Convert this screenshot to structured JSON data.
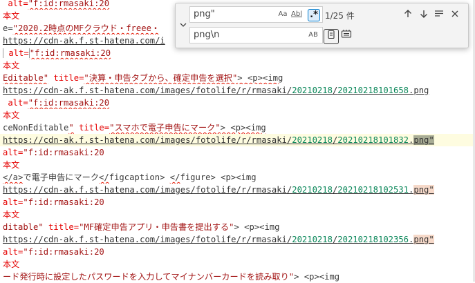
{
  "find_widget": {
    "find_value": "png\"",
    "replace_value": "png\\n",
    "match_case_label": "Aa",
    "whole_word_label": "Abl",
    "regex_label": ".*",
    "match_count": "1/25 件",
    "preserve_case_label": "AB",
    "toggle_icon": "chevron-down",
    "up_icon": "arrow-up",
    "down_icon": "arrow-down",
    "selection_icon": "find-in-selection",
    "close_icon": "close",
    "replace_one_icon": "replace",
    "replace_all_icon": "replace-all"
  },
  "colors": {
    "attr": "#e50000",
    "string": "#a31515",
    "url": "#333333",
    "number": "#098658",
    "match": "#f6d9c9",
    "current_match": "#a8ac94",
    "current_line": "#fefce0"
  },
  "editor": {
    "lines": [
      {
        "segs": [
          {
            "t": " alt=",
            "c": "attr"
          },
          {
            "t": "\"f:id:rmasaki:20",
            "c": "val",
            "sq": true
          }
        ]
      },
      {
        "segs": [
          {
            "t": "本文",
            "c": "attr"
          }
        ]
      },
      {
        "segs": [
          {
            "t": "e=",
            "c": "plain"
          },
          {
            "t": "\"2020.2時点のMFクラウド・freee・",
            "c": "val",
            "sq": true
          }
        ]
      },
      {
        "segs": [
          {
            "t": "https://cdn-ak.f.st-hatena.com/i",
            "c": "url"
          }
        ]
      },
      {
        "segs": [
          {
            "t": " alt=",
            "c": "attr",
            "box": true
          },
          {
            "t": "\"f:id:rmasaki:20",
            "c": "val",
            "sq": true
          }
        ]
      },
      {
        "segs": [
          {
            "t": "本文",
            "c": "attr"
          }
        ]
      },
      {
        "segs": [
          {
            "t": "Editable\"",
            "c": "val",
            "sq": true
          },
          {
            "t": " title=",
            "c": "attr"
          },
          {
            "t": "\"決算・申告タブから、確定申告を選択\"",
            "c": "val",
            "sq": true
          },
          {
            "t": "> <p><img",
            "c": "plain",
            "sq": true
          }
        ]
      },
      {
        "segs": [
          {
            "t": "https://cdn-ak.f.st-hatena.com/images/fotolife/r/rmasaki/",
            "c": "url"
          },
          {
            "t": "20210218",
            "c": "num"
          },
          {
            "t": "/",
            "c": "url"
          },
          {
            "t": "20210218101658",
            "c": "num"
          },
          {
            "t": ".png",
            "c": "url"
          }
        ]
      },
      {
        "segs": [
          {
            "t": " alt=",
            "c": "attr"
          },
          {
            "t": "\"f:id:rmasaki:20",
            "c": "val",
            "sq": true
          }
        ]
      },
      {
        "segs": [
          {
            "t": "本文",
            "c": "attr"
          }
        ]
      },
      {
        "segs": [
          {
            "t": "ceNonEditable",
            "c": "plain"
          },
          {
            "t": "\"",
            "c": "val",
            "sq": true
          },
          {
            "t": " title=",
            "c": "attr"
          },
          {
            "t": "\"スマホで電子申告にマーク\"",
            "c": "val",
            "sq": true
          },
          {
            "t": "> <p><img",
            "c": "plain",
            "sq": true
          }
        ]
      },
      {
        "cur": true,
        "segs": [
          {
            "t": "https://cdn-ak.f.st-hatena.com/images/fotolife/r/rmasaki/",
            "c": "url"
          },
          {
            "t": "20210218",
            "c": "num"
          },
          {
            "t": "/",
            "c": "url"
          },
          {
            "t": "20210218101832",
            "c": "num"
          },
          {
            "t": ".",
            "c": "url"
          },
          {
            "t": "png\"",
            "c": "url",
            "hl": "cur"
          }
        ]
      },
      {
        "segs": [
          {
            "t": "alt=",
            "c": "attr"
          },
          {
            "t": "\"f:id:rmasaki:20",
            "c": "val"
          }
        ]
      },
      {
        "segs": [
          {
            "t": "本文",
            "c": "attr"
          }
        ]
      },
      {
        "segs": [
          {
            "t": "</a>",
            "c": "plain",
            "sq": true
          },
          {
            "t": "で電子申告にマーク",
            "c": "plain"
          },
          {
            "t": "</",
            "c": "plain",
            "sq": true
          },
          {
            "t": "figcaption> ",
            "c": "plain"
          },
          {
            "t": "</",
            "c": "plain",
            "sq": true
          },
          {
            "t": "figure> <p><img",
            "c": "plain"
          }
        ]
      },
      {
        "segs": [
          {
            "t": "https://cdn-ak.f.st-hatena.com/images/fotolife/r/rmasaki/",
            "c": "url"
          },
          {
            "t": "20210218",
            "c": "num"
          },
          {
            "t": "/",
            "c": "url"
          },
          {
            "t": "20210218102531",
            "c": "num"
          },
          {
            "t": ".",
            "c": "url"
          },
          {
            "t": "png\"",
            "c": "url",
            "hl": "match"
          }
        ]
      },
      {
        "segs": [
          {
            "t": "alt=",
            "c": "attr"
          },
          {
            "t": "\"f:id:rmasaki:20",
            "c": "val"
          }
        ]
      },
      {
        "segs": [
          {
            "t": "本文",
            "c": "attr"
          }
        ]
      },
      {
        "segs": [
          {
            "t": "ditable\"",
            "c": "val"
          },
          {
            "t": " title=",
            "c": "attr"
          },
          {
            "t": "\"MF確定申告アプリ・申告書を提出する\"",
            "c": "val"
          },
          {
            "t": "> <p><img",
            "c": "plain"
          }
        ]
      },
      {
        "segs": [
          {
            "t": "https://cdn-ak.f.st-hatena.com/images/fotolife/r/rmasaki/",
            "c": "url"
          },
          {
            "t": "20210218",
            "c": "num"
          },
          {
            "t": "/",
            "c": "url"
          },
          {
            "t": "20210218102356",
            "c": "num"
          },
          {
            "t": ".",
            "c": "url"
          },
          {
            "t": "png\"",
            "c": "url",
            "hl": "match"
          }
        ]
      },
      {
        "segs": [
          {
            "t": "alt=",
            "c": "attr"
          },
          {
            "t": "\"f:id:rmasaki:20",
            "c": "val"
          }
        ]
      },
      {
        "segs": [
          {
            "t": "本文",
            "c": "attr"
          }
        ]
      },
      {
        "segs": [
          {
            "t": "ード発行時に設定したパスワードを入力してマイナンバーカードを読み取り\"",
            "c": "val"
          },
          {
            "t": "> <p><img",
            "c": "plain"
          }
        ]
      }
    ]
  }
}
